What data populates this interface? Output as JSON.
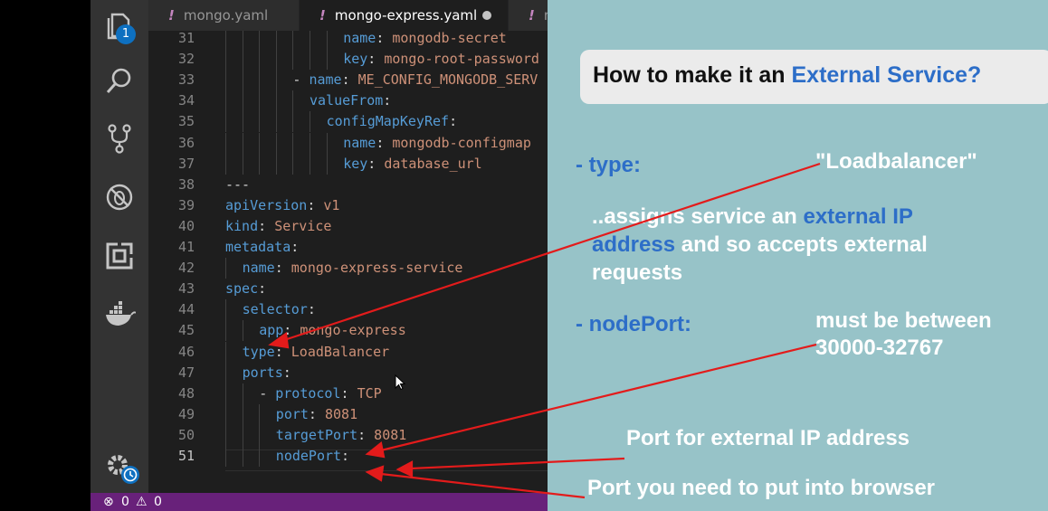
{
  "tabs": [
    {
      "label": "mongo.yaml"
    },
    {
      "label": "mongo-express.yaml",
      "modified": true
    },
    {
      "label": "m"
    }
  ],
  "activity": {
    "badge": "1"
  },
  "code": {
    "lines": [
      {
        "num": "31",
        "indent": 7,
        "key": "name",
        "value": "mongodb-secret"
      },
      {
        "num": "32",
        "indent": 7,
        "key": "key",
        "value": "mongo-root-password"
      },
      {
        "num": "33",
        "indent": 4,
        "dash": true,
        "key": "name",
        "value": "ME_CONFIG_MONGODB_SERV"
      },
      {
        "num": "34",
        "indent": 5,
        "key": "valueFrom",
        "value": ""
      },
      {
        "num": "35",
        "indent": 6,
        "key": "configMapKeyRef",
        "value": ""
      },
      {
        "num": "36",
        "indent": 7,
        "key": "name",
        "value": "mongodb-configmap"
      },
      {
        "num": "37",
        "indent": 7,
        "key": "key",
        "value": "database_url"
      },
      {
        "num": "38",
        "indent": 0,
        "raw": "---"
      },
      {
        "num": "39",
        "indent": 0,
        "key": "apiVersion",
        "value": "v1"
      },
      {
        "num": "40",
        "indent": 0,
        "key": "kind",
        "value": "Service"
      },
      {
        "num": "41",
        "indent": 0,
        "key": "metadata",
        "value": ""
      },
      {
        "num": "42",
        "indent": 1,
        "key": "name",
        "value": "mongo-express-service"
      },
      {
        "num": "43",
        "indent": 0,
        "key": "spec",
        "value": ""
      },
      {
        "num": "44",
        "indent": 1,
        "key": "selector",
        "value": ""
      },
      {
        "num": "45",
        "indent": 2,
        "key": "app",
        "value": "mongo-express"
      },
      {
        "num": "46",
        "indent": 1,
        "key": "type",
        "value": "LoadBalancer"
      },
      {
        "num": "47",
        "indent": 1,
        "key": "ports",
        "value": ""
      },
      {
        "num": "48",
        "indent": 2,
        "dash": true,
        "key": "protocol",
        "value": "TCP"
      },
      {
        "num": "49",
        "indent": 3,
        "key": "port",
        "value": "8081"
      },
      {
        "num": "50",
        "indent": 3,
        "key": "targetPort",
        "value": "8081"
      },
      {
        "num": "51",
        "indent": 3,
        "key": "nodePort",
        "value": "",
        "current": true
      }
    ]
  },
  "status": {
    "errors": "0",
    "warnings": "0"
  },
  "slide": {
    "question_prefix": "How to make it an ",
    "question_highlight": "External Service?",
    "type_label": "- type:",
    "type_value": "\"Loadbalancer\"",
    "desc_line1_prefix": "..assigns service an ",
    "desc_line1_highlight": "external IP",
    "desc_line2_highlight": "address",
    "desc_line2_suffix": " and so accepts external",
    "desc_line3": "requests",
    "nodeport_label": "- nodePort:",
    "nodeport_note_line1": "must be between",
    "nodeport_note_line2": "30000-32767",
    "port_external": "Port for external IP address",
    "port_browser": "Port you need to put into browser"
  },
  "colors": {
    "accent_blue": "#2d6ec8",
    "arrow_red": "#e31b1b",
    "status_bar": "#68217a",
    "slide_bg": "#97c3c8"
  }
}
